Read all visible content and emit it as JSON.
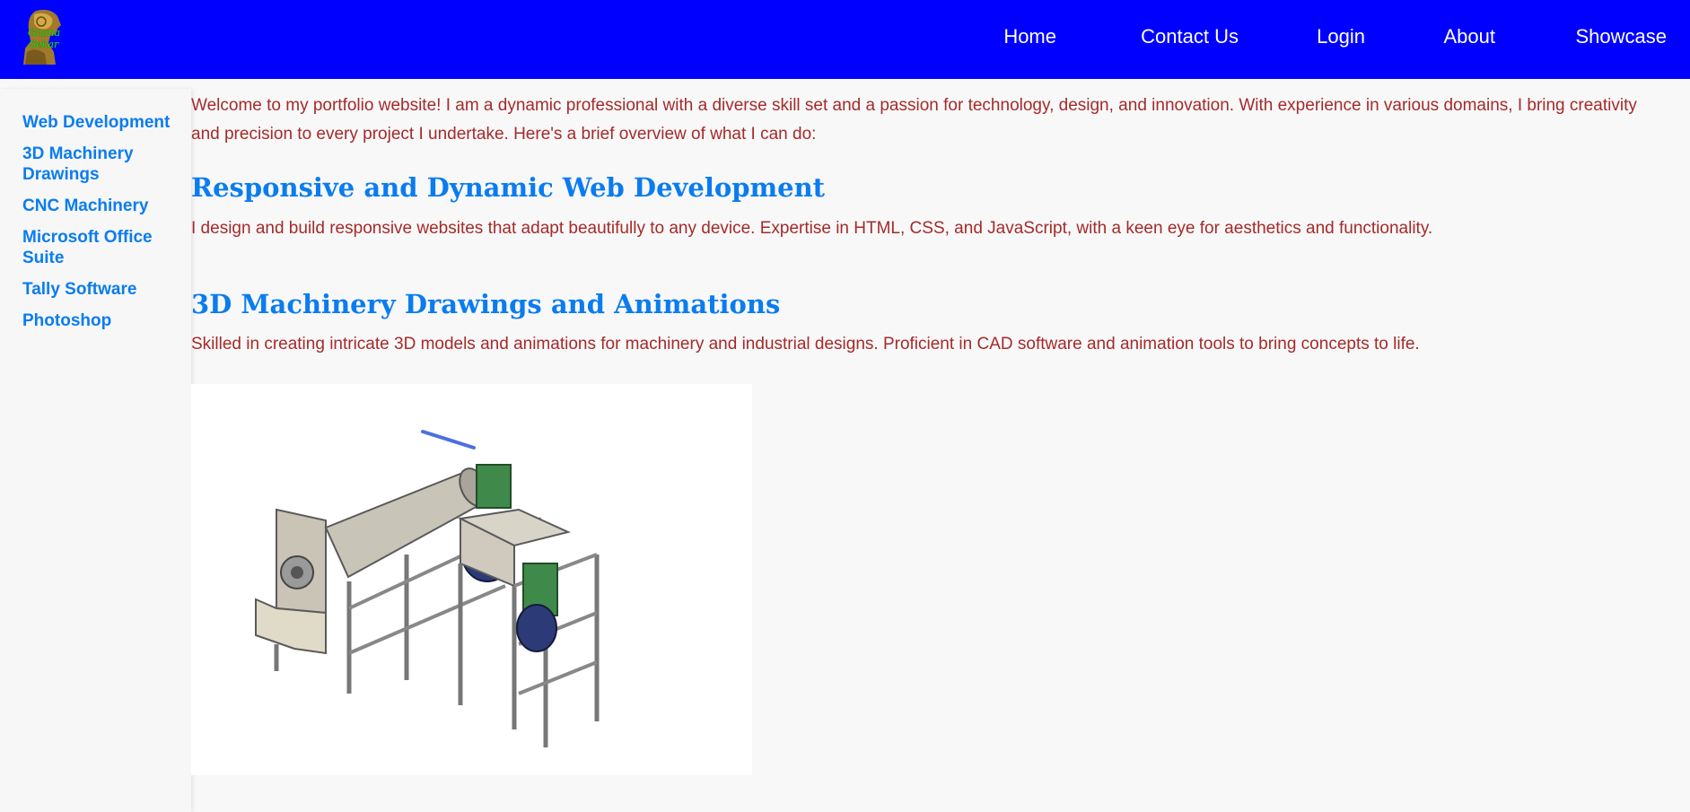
{
  "header": {
    "logo": {
      "alt": "Gnana Sekar logo",
      "line1": "Gnana",
      "line2": "Sekar"
    },
    "nav": [
      {
        "label": "Home"
      },
      {
        "label": "Contact Us"
      },
      {
        "label": "Login"
      },
      {
        "label": "About"
      },
      {
        "label": "Showcase"
      }
    ],
    "background_color": "#0000ff"
  },
  "sidebar": {
    "items": [
      {
        "label": "Web Development"
      },
      {
        "label": "3D Machinery Drawings"
      },
      {
        "label": "CNC Machinery"
      },
      {
        "label": "Microsoft Office Suite"
      },
      {
        "label": "Tally Software"
      },
      {
        "label": "Photoshop"
      }
    ],
    "link_color": "#0a7cf0"
  },
  "main": {
    "intro": "Welcome to my portfolio website! I am a dynamic professional with a diverse skill set and a passion for technology, design, and innovation. With experience in various domains, I bring creativity and precision to every project I undertake. Here's a brief overview of what I can do:",
    "sections": [
      {
        "heading": "Responsive and Dynamic Web Development",
        "text": "I design and build responsive websites that adapt beautifully to any device. Expertise in HTML, CSS, and JavaScript, with a keen eye for aesthetics and functionality."
      },
      {
        "heading": "3D Machinery Drawings and Animations",
        "text": "Skilled in creating intricate 3D models and animations for machinery and industrial designs. Proficient in CAD software and animation tools to bring concepts to life.",
        "image_alt": "3D machinery drawing of an industrial processing machine"
      }
    ],
    "text_color": "#a52a2a",
    "heading_color": "#0a7cf0"
  }
}
